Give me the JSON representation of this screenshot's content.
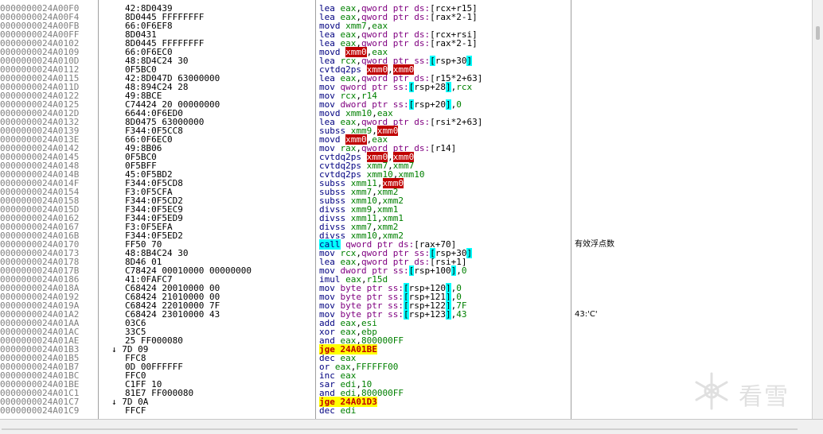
{
  "rows": [
    {
      "addr": "0000000024A00F0",
      "bytes": "42:8D0439",
      "dis": [
        [
          "m",
          "lea "
        ],
        [
          "reg",
          "eax"
        ],
        [
          "",
          ","
        ],
        [
          "sz",
          "qword ptr "
        ],
        [
          "seg",
          "ds:"
        ],
        [
          "",
          "[rcx+r15]"
        ]
      ],
      "comment": ""
    },
    {
      "addr": "0000000024A00F4",
      "bytes": "8D0445 FFFFFFFF",
      "dis": [
        [
          "m",
          "lea "
        ],
        [
          "reg",
          "eax"
        ],
        [
          "",
          ","
        ],
        [
          "sz",
          "qword ptr "
        ],
        [
          "seg",
          "ds:"
        ],
        [
          "",
          "[rax*2-1]"
        ]
      ],
      "comment": ""
    },
    {
      "addr": "0000000024A00FB",
      "bytes": "66:0F6EF8",
      "dis": [
        [
          "m",
          "movd "
        ],
        [
          "reg",
          "xmm7"
        ],
        [
          "",
          ","
        ],
        [
          "reg",
          "eax"
        ]
      ],
      "comment": ""
    },
    {
      "addr": "0000000024A00FF",
      "bytes": "8D0431",
      "dis": [
        [
          "m",
          "lea "
        ],
        [
          "reg",
          "eax"
        ],
        [
          "",
          ","
        ],
        [
          "sz",
          "qword ptr "
        ],
        [
          "seg",
          "ds:"
        ],
        [
          "",
          "[rcx+rsi]"
        ]
      ],
      "comment": ""
    },
    {
      "addr": "0000000024A0102",
      "bytes": "8D0445 FFFFFFFF",
      "dis": [
        [
          "m",
          "lea "
        ],
        [
          "reg",
          "eax"
        ],
        [
          "",
          ","
        ],
        [
          "sz",
          "qword ptr "
        ],
        [
          "seg",
          "ds:"
        ],
        [
          "",
          "[rax*2-1]"
        ]
      ],
      "comment": ""
    },
    {
      "addr": "0000000024A0109",
      "bytes": "66:0F6EC0",
      "dis": [
        [
          "m",
          "movd "
        ],
        [
          "hreg",
          "xmm0"
        ],
        [
          "",
          ","
        ],
        [
          "reg",
          "eax"
        ]
      ],
      "comment": ""
    },
    {
      "addr": "0000000024A010D",
      "bytes": "48:8D4C24 30",
      "dis": [
        [
          "m",
          "lea "
        ],
        [
          "reg",
          "rcx"
        ],
        [
          "",
          ","
        ],
        [
          "sz",
          "qword ptr "
        ],
        [
          "seg",
          "ss:"
        ],
        [
          "lb",
          "["
        ],
        [
          "",
          "rsp+30"
        ],
        [
          "lb",
          "]"
        ]
      ],
      "comment": ""
    },
    {
      "addr": "0000000024A0112",
      "bytes": "0F5BC0",
      "dis": [
        [
          "m",
          "cvtdq2ps "
        ],
        [
          "hreg",
          "xmm0"
        ],
        [
          "",
          ","
        ],
        [
          "hreg",
          "xmm0"
        ]
      ],
      "comment": ""
    },
    {
      "addr": "0000000024A0115",
      "bytes": "42:8D047D 63000000",
      "dis": [
        [
          "m",
          "lea "
        ],
        [
          "reg",
          "eax"
        ],
        [
          "",
          ","
        ],
        [
          "sz",
          "qword ptr "
        ],
        [
          "seg",
          "ds:"
        ],
        [
          "",
          "[r15*2+63]"
        ]
      ],
      "comment": ""
    },
    {
      "addr": "0000000024A011D",
      "bytes": "48:894C24 28",
      "dis": [
        [
          "m",
          "mov "
        ],
        [
          "sz",
          "qword ptr "
        ],
        [
          "seg",
          "ss:"
        ],
        [
          "lb",
          "["
        ],
        [
          "",
          "rsp+28"
        ],
        [
          "lb",
          "]"
        ],
        [
          "",
          ","
        ],
        [
          "reg",
          "rcx"
        ]
      ],
      "comment": ""
    },
    {
      "addr": "0000000024A0122",
      "bytes": "49:8BCE",
      "dis": [
        [
          "m",
          "mov "
        ],
        [
          "reg",
          "rcx"
        ],
        [
          "",
          ","
        ],
        [
          "reg",
          "r14"
        ]
      ],
      "comment": ""
    },
    {
      "addr": "0000000024A0125",
      "bytes": "C74424 20 00000000",
      "dis": [
        [
          "m",
          "mov "
        ],
        [
          "sz",
          "dword ptr "
        ],
        [
          "seg",
          "ss:"
        ],
        [
          "lb",
          "["
        ],
        [
          "",
          "rsp+20"
        ],
        [
          "lb",
          "]"
        ],
        [
          "",
          ","
        ],
        [
          "num",
          "0"
        ]
      ],
      "comment": ""
    },
    {
      "addr": "0000000024A012D",
      "bytes": "6644:0F6ED0",
      "dis": [
        [
          "m",
          "movd "
        ],
        [
          "reg",
          "xmm10"
        ],
        [
          "",
          ","
        ],
        [
          "reg",
          "eax"
        ]
      ],
      "comment": ""
    },
    {
      "addr": "0000000024A0132",
      "bytes": "8D0475 63000000",
      "dis": [
        [
          "m",
          "lea "
        ],
        [
          "reg",
          "eax"
        ],
        [
          "",
          ","
        ],
        [
          "sz",
          "qword ptr "
        ],
        [
          "seg",
          "ds:"
        ],
        [
          "",
          "[rsi*2+63]"
        ]
      ],
      "comment": ""
    },
    {
      "addr": "0000000024A0139",
      "bytes": "F344:0F5CC8",
      "dis": [
        [
          "m",
          "subss "
        ],
        [
          "reg",
          "xmm9"
        ],
        [
          "",
          ","
        ],
        [
          "hreg",
          "xmm0"
        ]
      ],
      "comment": ""
    },
    {
      "addr": "0000000024A013E",
      "bytes": "66:0F6EC0",
      "dis": [
        [
          "m",
          "movd "
        ],
        [
          "hreg",
          "xmm0"
        ],
        [
          "",
          ","
        ],
        [
          "reg",
          "eax"
        ]
      ],
      "comment": ""
    },
    {
      "addr": "0000000024A0142",
      "bytes": "49:8B06",
      "dis": [
        [
          "m",
          "mov "
        ],
        [
          "reg",
          "rax"
        ],
        [
          "",
          ","
        ],
        [
          "sz",
          "qword ptr "
        ],
        [
          "seg",
          "ds:"
        ],
        [
          "",
          "[r14]"
        ]
      ],
      "comment": ""
    },
    {
      "addr": "0000000024A0145",
      "bytes": "0F5BC0",
      "dis": [
        [
          "m",
          "cvtdq2ps "
        ],
        [
          "hreg",
          "xmm0"
        ],
        [
          "",
          ","
        ],
        [
          "hreg",
          "xmm0"
        ]
      ],
      "comment": ""
    },
    {
      "addr": "0000000024A0148",
      "bytes": "0F5BFF",
      "dis": [
        [
          "m",
          "cvtdq2ps "
        ],
        [
          "reg",
          "xmm7"
        ],
        [
          "",
          ","
        ],
        [
          "reg",
          "xmm7"
        ]
      ],
      "comment": ""
    },
    {
      "addr": "0000000024A014B",
      "bytes": "45:0F5BD2",
      "dis": [
        [
          "m",
          "cvtdq2ps "
        ],
        [
          "reg",
          "xmm10"
        ],
        [
          "",
          ","
        ],
        [
          "reg",
          "xmm10"
        ]
      ],
      "comment": ""
    },
    {
      "addr": "0000000024A014F",
      "bytes": "F344:0F5CD8",
      "dis": [
        [
          "m",
          "subss "
        ],
        [
          "reg",
          "xmm11"
        ],
        [
          "",
          ","
        ],
        [
          "hreg",
          "xmm0"
        ]
      ],
      "comment": ""
    },
    {
      "addr": "0000000024A0154",
      "bytes": "F3:0F5CFA",
      "dis": [
        [
          "m",
          "subss "
        ],
        [
          "reg",
          "xmm7"
        ],
        [
          "",
          ","
        ],
        [
          "reg",
          "xmm2"
        ]
      ],
      "comment": ""
    },
    {
      "addr": "0000000024A0158",
      "bytes": "F344:0F5CD2",
      "dis": [
        [
          "m",
          "subss "
        ],
        [
          "reg",
          "xmm10"
        ],
        [
          "",
          ","
        ],
        [
          "reg",
          "xmm2"
        ]
      ],
      "comment": ""
    },
    {
      "addr": "0000000024A015D",
      "bytes": "F344:0F5EC9",
      "dis": [
        [
          "m",
          "divss "
        ],
        [
          "reg",
          "xmm9"
        ],
        [
          "",
          ","
        ],
        [
          "reg",
          "xmm1"
        ]
      ],
      "comment": ""
    },
    {
      "addr": "0000000024A0162",
      "bytes": "F344:0F5ED9",
      "dis": [
        [
          "m",
          "divss "
        ],
        [
          "reg",
          "xmm11"
        ],
        [
          "",
          ","
        ],
        [
          "reg",
          "xmm1"
        ]
      ],
      "comment": ""
    },
    {
      "addr": "0000000024A0167",
      "bytes": "F3:0F5EFA",
      "dis": [
        [
          "m",
          "divss "
        ],
        [
          "reg",
          "xmm7"
        ],
        [
          "",
          ","
        ],
        [
          "reg",
          "xmm2"
        ]
      ],
      "comment": ""
    },
    {
      "addr": "0000000024A016B",
      "bytes": "F344:0F5ED2",
      "dis": [
        [
          "m",
          "divss "
        ],
        [
          "reg",
          "xmm10"
        ],
        [
          "",
          ","
        ],
        [
          "reg",
          "xmm2"
        ]
      ],
      "comment": ""
    },
    {
      "addr": "0000000024A0170",
      "bytes": "FF50 70",
      "dis": [
        [
          "call",
          "call"
        ],
        [
          "",
          " "
        ],
        [
          "sz",
          "qword ptr "
        ],
        [
          "seg",
          "ds:"
        ],
        [
          "",
          "[rax+70]"
        ]
      ],
      "comment": "有效浮点数"
    },
    {
      "addr": "0000000024A0173",
      "bytes": "48:8B4C24 30",
      "dis": [
        [
          "m",
          "mov "
        ],
        [
          "reg",
          "rcx"
        ],
        [
          "",
          ","
        ],
        [
          "sz",
          "qword ptr "
        ],
        [
          "seg",
          "ss:"
        ],
        [
          "lb",
          "["
        ],
        [
          "",
          "rsp+30"
        ],
        [
          "lb",
          "]"
        ]
      ],
      "comment": ""
    },
    {
      "addr": "0000000024A0178",
      "bytes": "8D46 01",
      "dis": [
        [
          "m",
          "lea "
        ],
        [
          "reg",
          "eax"
        ],
        [
          "",
          ","
        ],
        [
          "sz",
          "qword ptr "
        ],
        [
          "seg",
          "ds:"
        ],
        [
          "",
          "[rsi+1]"
        ]
      ],
      "comment": ""
    },
    {
      "addr": "0000000024A017B",
      "bytes": "C78424 00010000 00000000",
      "dis": [
        [
          "m",
          "mov "
        ],
        [
          "sz",
          "dword ptr "
        ],
        [
          "seg",
          "ss:"
        ],
        [
          "lb",
          "["
        ],
        [
          "",
          "rsp+100"
        ],
        [
          "lb",
          "]"
        ],
        [
          "",
          ","
        ],
        [
          "num",
          "0"
        ]
      ],
      "comment": ""
    },
    {
      "addr": "0000000024A0186",
      "bytes": "41:0FAFC7",
      "dis": [
        [
          "m",
          "imul "
        ],
        [
          "reg",
          "eax"
        ],
        [
          "",
          ","
        ],
        [
          "reg",
          "r15d"
        ]
      ],
      "comment": ""
    },
    {
      "addr": "0000000024A018A",
      "bytes": "C68424 20010000 00",
      "dis": [
        [
          "m",
          "mov "
        ],
        [
          "sz",
          "byte ptr "
        ],
        [
          "seg",
          "ss:"
        ],
        [
          "lb",
          "["
        ],
        [
          "",
          "rsp+120"
        ],
        [
          "lb",
          "]"
        ],
        [
          "",
          ","
        ],
        [
          "num",
          "0"
        ]
      ],
      "comment": ""
    },
    {
      "addr": "0000000024A0192",
      "bytes": "C68424 21010000 00",
      "dis": [
        [
          "m",
          "mov "
        ],
        [
          "sz",
          "byte ptr "
        ],
        [
          "seg",
          "ss:"
        ],
        [
          "lb",
          "["
        ],
        [
          "",
          "rsp+121"
        ],
        [
          "lb",
          "]"
        ],
        [
          "",
          ","
        ],
        [
          "num",
          "0"
        ]
      ],
      "comment": ""
    },
    {
      "addr": "0000000024A019A",
      "bytes": "C68424 22010000 7F",
      "dis": [
        [
          "m",
          "mov "
        ],
        [
          "sz",
          "byte ptr "
        ],
        [
          "seg",
          "ss:"
        ],
        [
          "lb",
          "["
        ],
        [
          "",
          "rsp+122"
        ],
        [
          "lb",
          "]"
        ],
        [
          "",
          ","
        ],
        [
          "num",
          "7F"
        ]
      ],
      "comment": ""
    },
    {
      "addr": "0000000024A01A2",
      "bytes": "C68424 23010000 43",
      "dis": [
        [
          "m",
          "mov "
        ],
        [
          "sz",
          "byte ptr "
        ],
        [
          "seg",
          "ss:"
        ],
        [
          "lb",
          "["
        ],
        [
          "",
          "rsp+123"
        ],
        [
          "lb",
          "]"
        ],
        [
          "",
          ","
        ],
        [
          "num",
          "43"
        ]
      ],
      "comment": "43:'C'"
    },
    {
      "addr": "0000000024A01AA",
      "bytes": "03C6",
      "dis": [
        [
          "m",
          "add "
        ],
        [
          "reg",
          "eax"
        ],
        [
          "",
          ","
        ],
        [
          "reg",
          "esi"
        ]
      ],
      "comment": ""
    },
    {
      "addr": "0000000024A01AC",
      "bytes": "33C5",
      "dis": [
        [
          "m",
          "xor "
        ],
        [
          "reg",
          "eax"
        ],
        [
          "",
          ","
        ],
        [
          "reg",
          "ebp"
        ]
      ],
      "comment": ""
    },
    {
      "addr": "0000000024A01AE",
      "bytes": "25 FF000080",
      "dis": [
        [
          "m",
          "and "
        ],
        [
          "reg",
          "eax"
        ],
        [
          "",
          ","
        ],
        [
          "num",
          "800000FF"
        ]
      ],
      "comment": ""
    },
    {
      "addr": "0000000024A01B3",
      "bytes": "7D 09",
      "branch": true,
      "dis": [
        [
          "jmp",
          "jge 24A01BE"
        ]
      ],
      "comment": ""
    },
    {
      "addr": "0000000024A01B5",
      "bytes": "FFC8",
      "dis": [
        [
          "m",
          "dec "
        ],
        [
          "reg",
          "eax"
        ]
      ],
      "comment": ""
    },
    {
      "addr": "0000000024A01B7",
      "bytes": "0D 00FFFFFF",
      "dis": [
        [
          "m",
          "or "
        ],
        [
          "reg",
          "eax"
        ],
        [
          "",
          ","
        ],
        [
          "num",
          "FFFFFF00"
        ]
      ],
      "comment": ""
    },
    {
      "addr": "0000000024A01BC",
      "bytes": "FFC0",
      "dis": [
        [
          "m",
          "inc "
        ],
        [
          "reg",
          "eax"
        ]
      ],
      "comment": ""
    },
    {
      "addr": "0000000024A01BE",
      "bytes": "C1FF 10",
      "dis": [
        [
          "m",
          "sar "
        ],
        [
          "reg",
          "edi"
        ],
        [
          "",
          ","
        ],
        [
          "num",
          "10"
        ]
      ],
      "comment": ""
    },
    {
      "addr": "0000000024A01C1",
      "bytes": "81E7 FF000080",
      "dis": [
        [
          "m",
          "and "
        ],
        [
          "reg",
          "edi"
        ],
        [
          "",
          ","
        ],
        [
          "num",
          "800000FF"
        ]
      ],
      "comment": ""
    },
    {
      "addr": "0000000024A01C7",
      "bytes": "7D 0A",
      "branch": true,
      "dis": [
        [
          "jmp",
          "jge 24A01D3"
        ]
      ],
      "comment": ""
    },
    {
      "addr": "0000000024A01C9",
      "bytes": "FFCF",
      "dis": [
        [
          "m",
          "dec "
        ],
        [
          "reg",
          "edi"
        ]
      ],
      "comment": ""
    }
  ],
  "watermark": {
    "text": "看雪",
    "icon": "snowflake-logo"
  },
  "scrollbar": {
    "position_fraction": 0.06
  }
}
